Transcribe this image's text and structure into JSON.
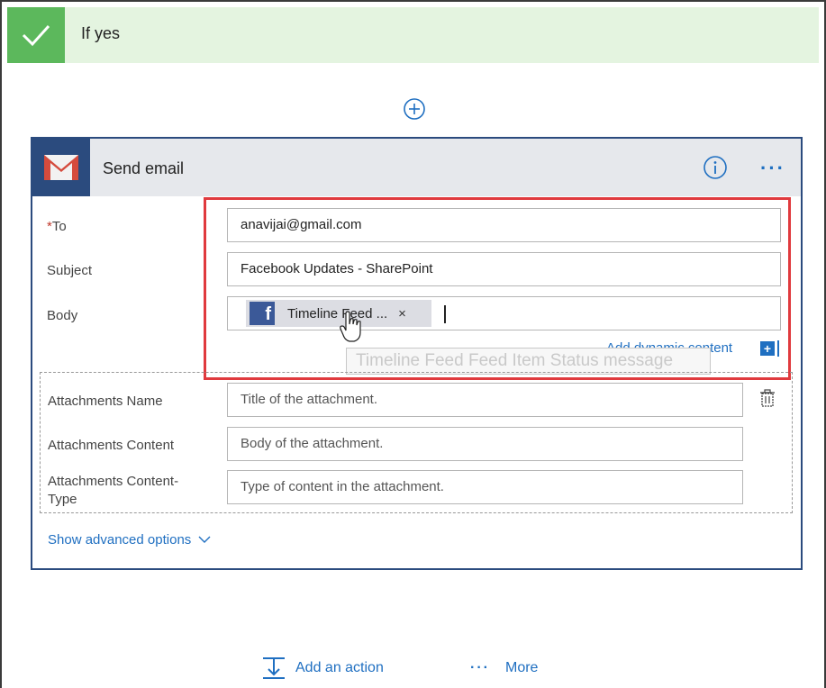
{
  "condition": {
    "title": "If yes"
  },
  "card": {
    "title": "Send email",
    "fields": {
      "to": {
        "required_mark": "*",
        "label": "To",
        "value": "anavijai@gmail.com"
      },
      "subject": {
        "label": "Subject",
        "value": "Facebook Updates - SharePoint"
      },
      "body": {
        "label": "Body",
        "token_label": "Timeline Feed ...",
        "token_remove": "×"
      }
    },
    "dynamic_content_link": "Add dynamic content",
    "dynamic_content_plus": "+",
    "tooltip": "Timeline Feed Feed Item Status message",
    "attachments": {
      "name": {
        "label": "Attachments Name",
        "placeholder": "Title of the attachment."
      },
      "content": {
        "label": "Attachments Content",
        "placeholder": "Body of the attachment."
      },
      "content_type": {
        "label_line1": "Attachments Content-",
        "label_line2": "Type",
        "placeholder": "Type of content in the attachment."
      }
    },
    "show_advanced": "Show advanced options",
    "more_menu": "···"
  },
  "footer": {
    "add_action": "Add an action",
    "more_dots": "···",
    "more": "More"
  },
  "colors": {
    "accent": "#1f6fc1",
    "success": "#5cb85c",
    "card_border": "#2b4b7e",
    "highlight": "#e03a3e",
    "facebook": "#3b5998"
  },
  "icons": {
    "check": "check-icon",
    "add": "add-circle-icon",
    "gmail": "gmail-icon",
    "info": "info-icon",
    "facebook": "facebook-icon",
    "delete": "trash-icon",
    "chevron": "chevron-down-icon",
    "action": "add-action-icon",
    "cursor": "hand-cursor-icon"
  }
}
